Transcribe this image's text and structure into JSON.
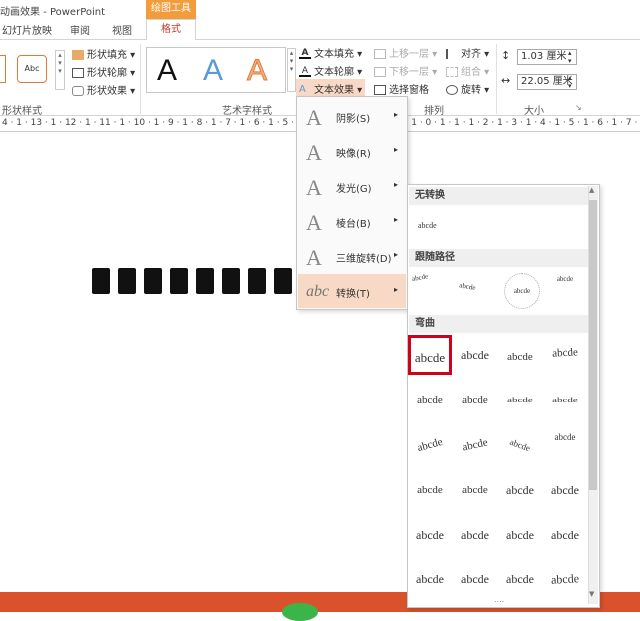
{
  "window": {
    "title": "动画效果 - PowerPoint",
    "context_tab": "绘图工具"
  },
  "tabs": [
    "幻灯片放映",
    "审阅",
    "视图"
  ],
  "active_tab": "格式",
  "ribbon": {
    "shape_style_label": "形状样式",
    "shape_sample": "Abc",
    "shape_fill": "形状填充",
    "shape_outline": "形状轮廓",
    "shape_effect": "形状效果",
    "wordart_label": "艺术字样式",
    "text_fill": "文本填充",
    "text_outline": "文本轮廓",
    "text_effect": "文本效果",
    "arrange_label": "排列",
    "bring_forward": "上移一层",
    "send_backward": "下移一层",
    "selection_pane": "选择窗格",
    "align": "对齐",
    "group": "组合",
    "rotate": "旋转",
    "size_label": "大小",
    "height": "1.03 厘米",
    "width": "22.05 厘米",
    "wa_letter": "A"
  },
  "ruler_text": "4 · 1 · 13 · 1 · 12 · 1 · 11 · 1 · 10 · 1 · 9 · 1 · 8 · 1 · 7 · 1 · 6 · 1 · 5 · 1 · 4 · 1 · 3 · 1 · 2 · 1 · 1 · 1 · 0 · 1 · 1 · 1 · 2 · 1 · 3 · 1 · 4 · 1 · 5 · 1 · 6 · 1 · 7 · 1 · 8 · 1 · 9 · 1 · 10 · 1 · 11 · 1 · 12 · 1 · 13 · 1 · 14",
  "menu": {
    "items": [
      {
        "label": "阴影(S)",
        "icon": "A"
      },
      {
        "label": "映像(R)",
        "icon": "A"
      },
      {
        "label": "发光(G)",
        "icon": "A"
      },
      {
        "label": "棱台(B)",
        "icon": "A"
      },
      {
        "label": "三维旋转(D)",
        "icon": "A"
      },
      {
        "label": "转换(T)",
        "icon": "abc"
      }
    ],
    "arrow": "▸"
  },
  "gallery": {
    "no_transform_header": "无转换",
    "no_transform_sample": "abcde",
    "follow_path_header": "跟随路径",
    "follow_path_samples": [
      "abcde",
      "abcde",
      "abcde",
      "abcde"
    ],
    "warp_header": "弯曲",
    "sample": "abcde",
    "more": "....",
    "scroll_up": "▲",
    "scroll_down": "▼"
  },
  "colors": {
    "accent": "#f39c3c",
    "selection": "#d0021b",
    "status_bar": "#d9522c",
    "menu_highlight": "#f8d9c6"
  }
}
